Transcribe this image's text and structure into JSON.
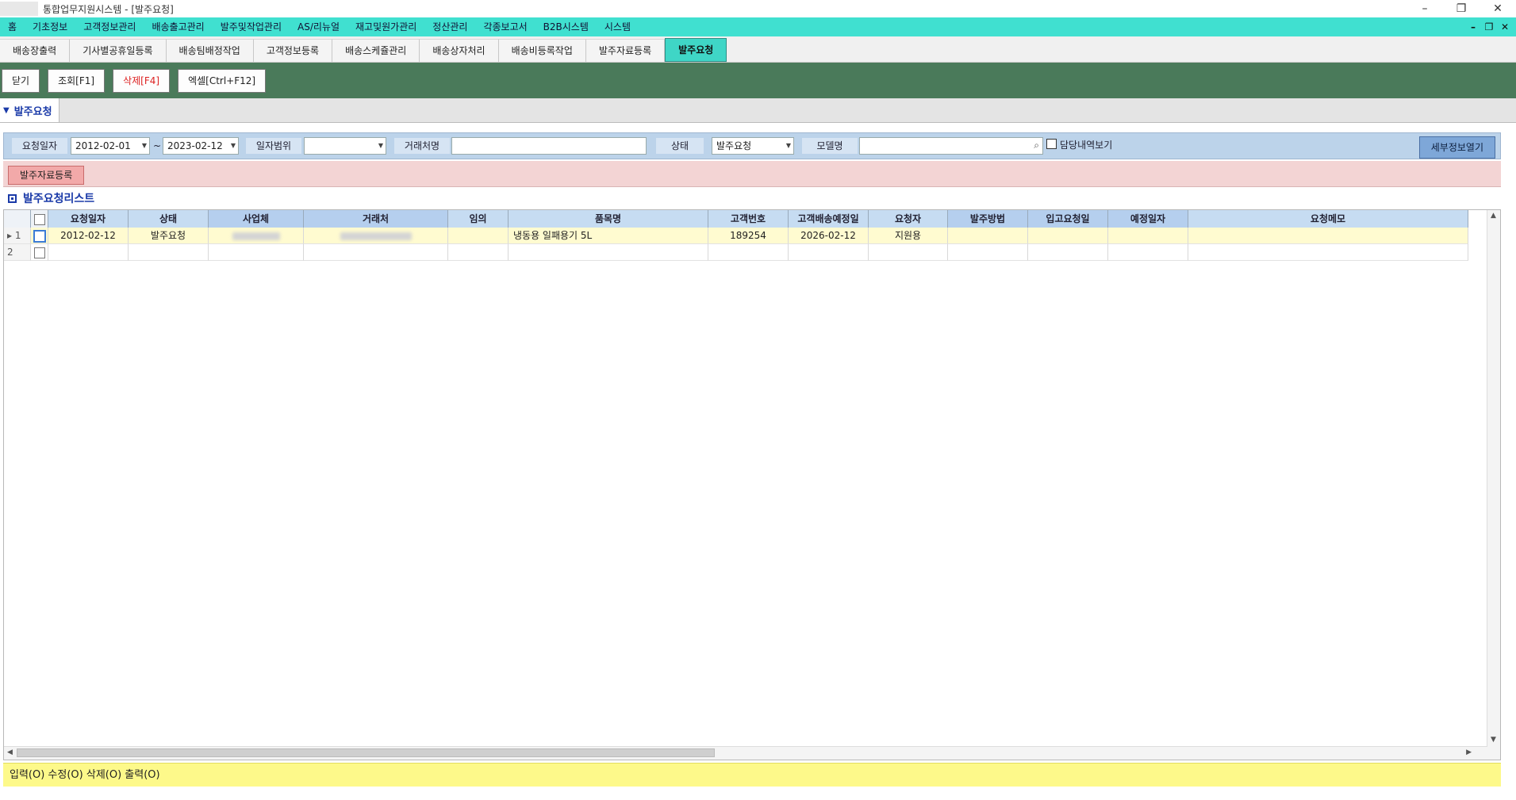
{
  "window": {
    "title": "통합업무지원시스템 - [발주요청]",
    "controls": [
      "–",
      "❐",
      "✕"
    ]
  },
  "menubar": {
    "items": [
      "홈",
      "기초정보",
      "고객정보관리",
      "배송출고관리",
      "발주및작업관리",
      "AS/리뉴얼",
      "재고및원가관리",
      "정산관리",
      "각종보고서",
      "B2B시스템",
      "시스템"
    ],
    "right_controls": [
      "–",
      "❐",
      "✕"
    ]
  },
  "tabs": [
    "배송장출력",
    "기사별공휴일등록",
    "배송팀배정작업",
    "고객정보등록",
    "배송스케쥴관리",
    "배송상자처리",
    "배송비등록작업",
    "발주자료등록",
    "발주요청"
  ],
  "active_tab_index": 8,
  "toolbar": {
    "close": "닫기",
    "search": "조회[F1]",
    "delete": "삭제[F4]",
    "excel": "엑셀[Ctrl+F12]"
  },
  "doc_tab": {
    "label": "발주요청"
  },
  "filters": {
    "date_label": "요청일자",
    "date_from": "2012-02-01",
    "tilde": "~",
    "date_to": "2023-02-12",
    "range_label": "일자범위",
    "range_value": "",
    "vendor_label": "거래처명",
    "vendor_value": "",
    "status_label": "상태",
    "status_value": "발주요청",
    "model_label": "모델명",
    "model_value": "",
    "mine_label": "담당내역보기",
    "detail_button": "세부정보열기"
  },
  "actions": {
    "register_order": "발주자료등록"
  },
  "grid": {
    "title": "발주요청리스트",
    "columns": [
      "요청일자",
      "상태",
      "사업체",
      "거래처",
      "임의",
      "품목명",
      "고객번호",
      "고객배송예정일",
      "요청자",
      "발주방법",
      "입고요청일",
      "예정일자",
      "요청메모"
    ],
    "rows": [
      {
        "num": "1",
        "marker": "▸",
        "cells": [
          "2012-02-12",
          "발주요청",
          "",
          "",
          "",
          "냉동용 일패용기 5L",
          "189254",
          "2026-02-12",
          "지원용",
          "",
          "",
          "",
          ""
        ]
      },
      {
        "num": "2",
        "marker": "",
        "cells": [
          "",
          "",
          "",
          "",
          "",
          "",
          "",
          "",
          "",
          "",
          "",
          "",
          ""
        ]
      }
    ]
  },
  "statusbar": {
    "text": "입력(O) 수정(O) 삭제(O) 출력(O)"
  },
  "colors": {
    "menubar": "#40e0d0",
    "toolbar": "#4a7a5a",
    "filterbar": "#bcd3ea",
    "pinkbar": "#f3d4d4",
    "selected_row": "#fffbd0",
    "statusbar": "#fdf98a"
  },
  "icons": {
    "search": "search-icon",
    "dropdown": "chevron-down-icon",
    "grid_title": "list-box-icon"
  }
}
